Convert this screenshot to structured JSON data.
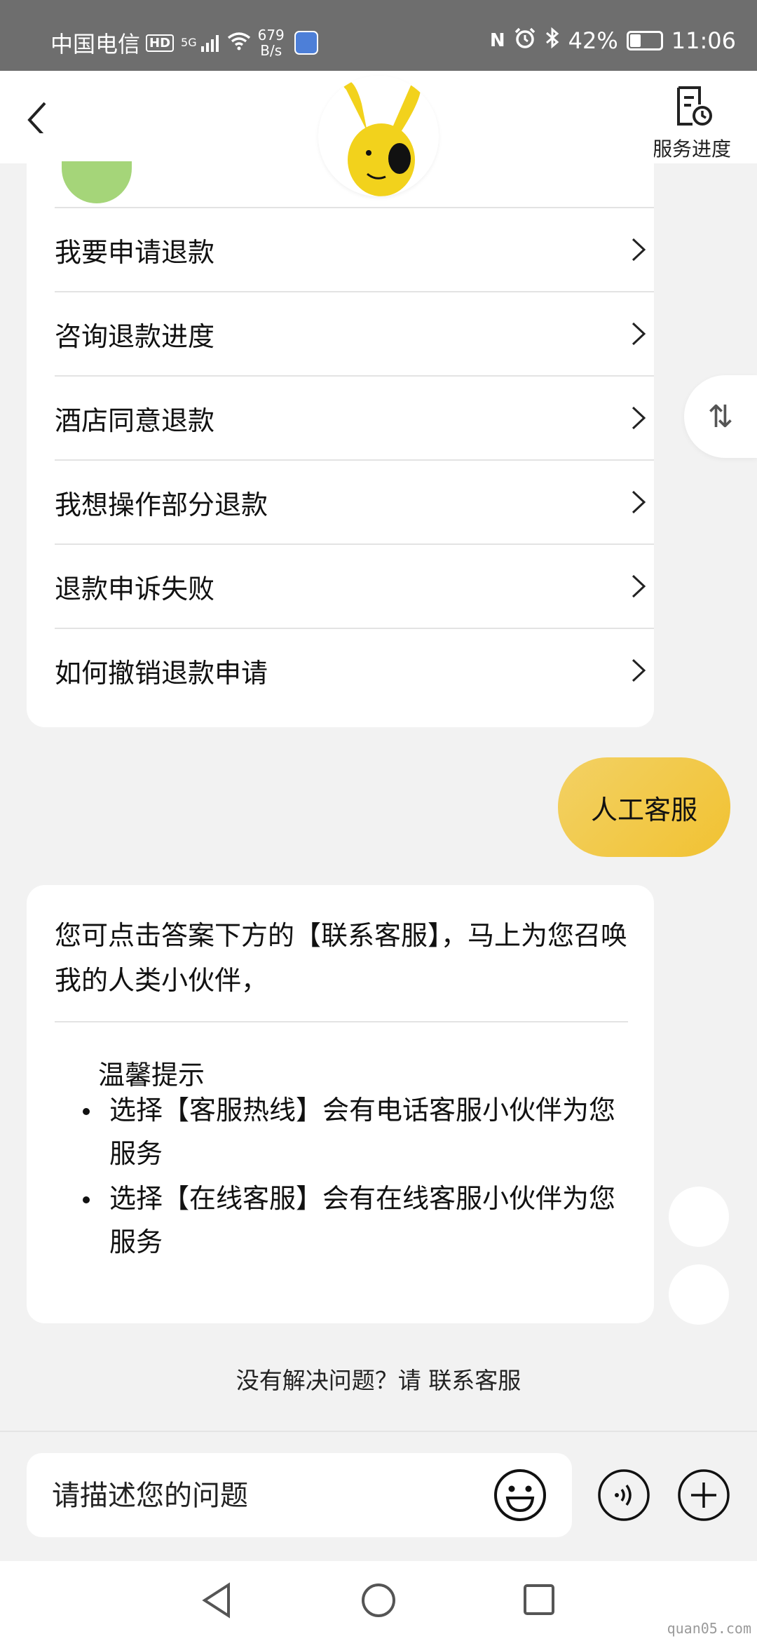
{
  "status_bar": {
    "carrier": "中国电信",
    "hd": "HD",
    "network": "5G",
    "speed_value": "679",
    "speed_unit": "B/s",
    "battery": "42%",
    "battery_level": 0.42,
    "time": "11:06"
  },
  "header": {
    "progress_label": "服务进度"
  },
  "menu": {
    "items": [
      {
        "label": "我要申请退款"
      },
      {
        "label": "咨询退款进度"
      },
      {
        "label": "酒店同意退款"
      },
      {
        "label": "我想操作部分退款"
      },
      {
        "label": "退款申诉失败"
      },
      {
        "label": "如何撤销退款申请"
      }
    ]
  },
  "swap_icon": "⇅",
  "user_message": "人工客服",
  "answer": {
    "text": "您可点击答案下方的【联系客服】，马上为您召唤我的人类小伙伴，",
    "tip_title": "温馨提示",
    "tips": [
      "选择【客服热线】会有电话客服小伙伴为您服务",
      "选择【在线客服】会有在线客服小伙伴为您服务"
    ]
  },
  "unresolved": {
    "prefix": "没有解决问题？请",
    "link": "联系客服"
  },
  "input": {
    "placeholder": "请描述您的问题"
  },
  "watermark": "quan05.com",
  "colors": {
    "accent": "#f1c232",
    "status_bar": "#6e6e6e",
    "background": "#f2f2f2"
  }
}
